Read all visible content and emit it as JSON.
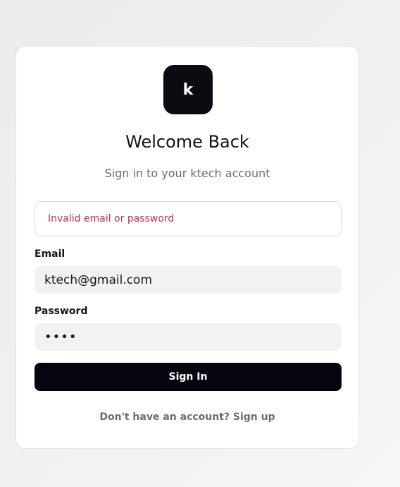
{
  "logo": {
    "letter": "k"
  },
  "header": {
    "title": "Welcome Back",
    "subtitle": "Sign in to your ktech account"
  },
  "alert": {
    "message": "Invalid email or password"
  },
  "form": {
    "email_label": "Email",
    "email_value": "ktech@gmail.com",
    "password_label": "Password",
    "password_value": "••••"
  },
  "actions": {
    "signin_label": "Sign In"
  },
  "footer": {
    "prompt": "Don't have an account?",
    "signup_label": "Sign up"
  },
  "colors": {
    "primary": "#06050f",
    "error": "#c0304f",
    "muted": "#6b6b75"
  }
}
